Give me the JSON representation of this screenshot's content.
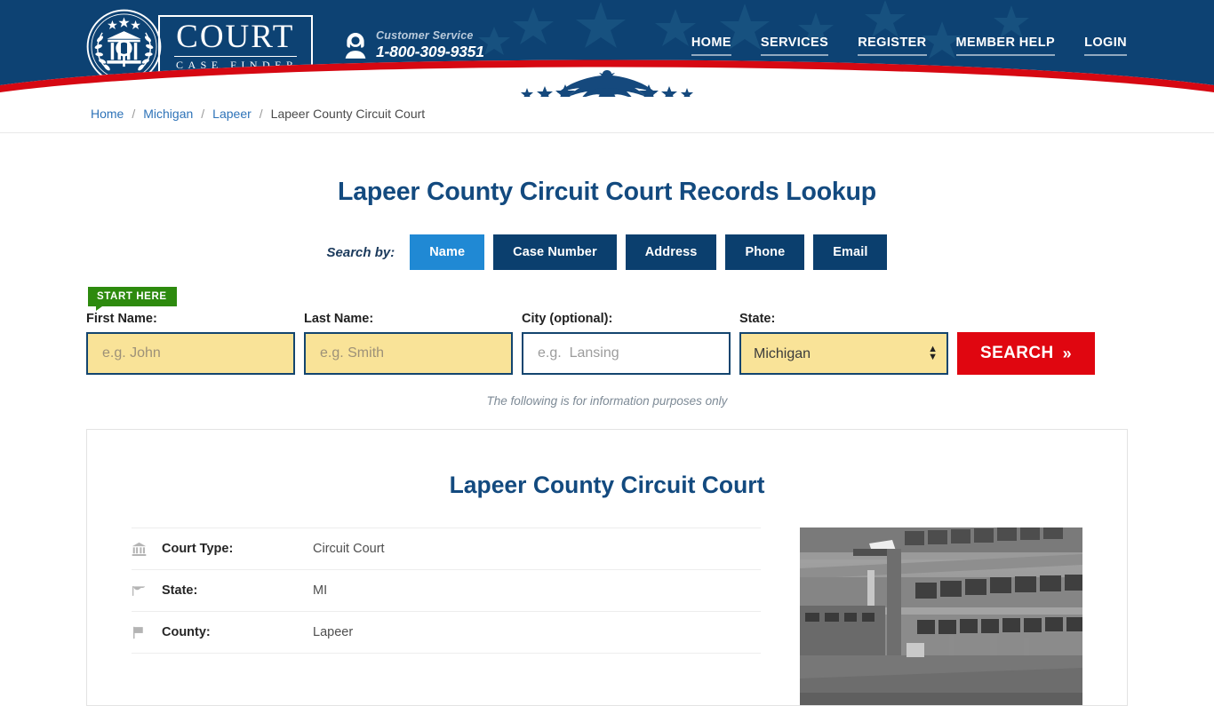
{
  "header": {
    "logo": {
      "seal_icon": "court-seal-icon",
      "title": "COURT",
      "subtitle": "CASE FINDER"
    },
    "customer_service": {
      "icon": "headset-icon",
      "label": "Customer Service",
      "phone": "1-800-309-9351"
    },
    "nav": [
      {
        "label": "HOME"
      },
      {
        "label": "SERVICES"
      },
      {
        "label": "REGISTER"
      },
      {
        "label": "MEMBER HELP"
      },
      {
        "label": "LOGIN"
      }
    ],
    "colors": {
      "navy": "#0d4273",
      "red": "#d60812",
      "white": "#ffffff"
    }
  },
  "breadcrumb": {
    "items": [
      {
        "label": "Home",
        "current": false
      },
      {
        "label": "Michigan",
        "current": false
      },
      {
        "label": "Lapeer",
        "current": false
      },
      {
        "label": "Lapeer County Circuit Court",
        "current": true
      }
    ],
    "separator": "/"
  },
  "main": {
    "page_title": "Lapeer County Circuit Court Records Lookup",
    "search_by_label": "Search by:",
    "tabs": [
      {
        "label": "Name",
        "active": true
      },
      {
        "label": "Case Number",
        "active": false
      },
      {
        "label": "Address",
        "active": false
      },
      {
        "label": "Phone",
        "active": false
      },
      {
        "label": "Email",
        "active": false
      }
    ],
    "start_here_badge": "START HERE",
    "form": {
      "first_name": {
        "label": "First Name:",
        "placeholder": "e.g. John",
        "value": ""
      },
      "last_name": {
        "label": "Last Name:",
        "placeholder": "e.g. Smith",
        "value": ""
      },
      "city": {
        "label": "City (optional):",
        "placeholder": "e.g.  Lansing",
        "value": ""
      },
      "state": {
        "label": "State:",
        "value": "Michigan",
        "options": [
          "Michigan"
        ]
      },
      "search_button": "SEARCH",
      "search_button_chevron": "»"
    },
    "disclaimer": "The following is for information purposes only",
    "card": {
      "title": "Lapeer County Circuit Court",
      "details": [
        {
          "icon": "bank-icon",
          "label": "Court Type:",
          "value": "Circuit Court"
        },
        {
          "icon": "flag-waving-icon",
          "label": "State:",
          "value": "MI"
        },
        {
          "icon": "flag-icon",
          "label": "County:",
          "value": "Lapeer"
        }
      ],
      "photo_alt": "courthouse-building-photo"
    }
  },
  "colors": {
    "accent_blue": "#2089d4",
    "tab_navy": "#0b3f6e",
    "title_blue": "#134a7f",
    "field_yellow": "#f9e398",
    "field_border": "#13456f",
    "search_red": "#e00610",
    "badge_green": "#2d8a0e"
  }
}
